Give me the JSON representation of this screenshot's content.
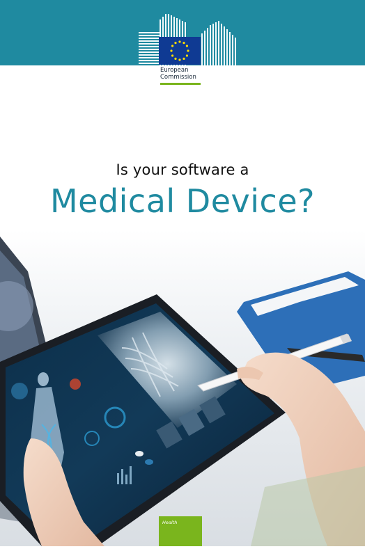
{
  "header": {
    "org_line1": "European",
    "org_line2": "Commission",
    "band_color": "#1f8aa0",
    "flag_color": "#0f3a93",
    "star_color": "#ffdd00"
  },
  "title": {
    "line1": "Is your software a",
    "line2": "Medical Device?",
    "accent_color": "#1f8aa0"
  },
  "photo": {
    "subject": "hand-holding-tablet-with-xray-and-stylus"
  },
  "footer": {
    "badge_label": "Health",
    "badge_color": "#7ab51d"
  }
}
